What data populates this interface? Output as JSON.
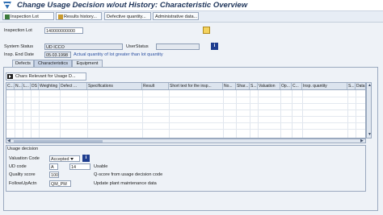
{
  "window": {
    "title": "Change Usage Decision w/out History: Characteristic Overview"
  },
  "toolbar": {
    "inspection_lot_label": "Inspection Lot",
    "results_history_label": "Results history...",
    "defective_quantity_label": "Defective quantity...",
    "administrative_data_label": "Administrative data..."
  },
  "header": {
    "inspection_lot_label": "Inspection Lot",
    "inspection_lot_value": "140000000000",
    "system_status_label": "System Status",
    "system_status_value": "UD ICCO",
    "user_status_label": "UserStatus",
    "user_status_value": "",
    "insp_end_date_label": "Insp. End Date",
    "insp_end_date_value": "05.03.1998",
    "insp_end_date_message": "Actual quantity of lot greater than lot quantity"
  },
  "tabs": [
    {
      "label": "Defects",
      "active": false
    },
    {
      "label": "Characteristics",
      "active": true
    },
    {
      "label": "Equipment",
      "active": false
    }
  ],
  "chars_button": {
    "label": "Chars Relevant for Usage D..."
  },
  "table": {
    "columns": [
      "C...",
      "N...",
      "L...",
      "DS",
      "Weighting",
      "Defect ...",
      "Specifications",
      "Result",
      "Short text for the insp...",
      "No...",
      "Shar...",
      "S...",
      "Valuation",
      "Op...",
      "C...",
      "Insp. quantity",
      "S...",
      "Data"
    ]
  },
  "usage_decision": {
    "group_title": "Usage decision",
    "valuation_code_label": "Valuation Code",
    "valuation_code_value": "Accepted",
    "ud_code_label": "UD code",
    "ud_code_value": "A",
    "ud_code_value2": "14",
    "ud_code_text": "Usable",
    "quality_score_label": "Quality score",
    "quality_score_value": "100",
    "quality_score_text": "Q-score from usage decision code",
    "follow_up_label": "FollowUpActn",
    "follow_up_value": "QM_PM",
    "follow_up_text": "Update plant maintenance data"
  }
}
